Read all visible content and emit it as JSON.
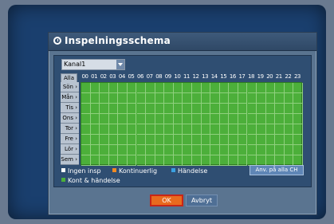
{
  "dialog": {
    "title": "Inspelningsschema",
    "channel_select": "Kanal1",
    "all_label": "Alla",
    "hours": [
      "00",
      "01",
      "02",
      "03",
      "04",
      "05",
      "06",
      "07",
      "08",
      "09",
      "10",
      "11",
      "12",
      "13",
      "14",
      "15",
      "16",
      "17",
      "18",
      "19",
      "20",
      "21",
      "22",
      "23"
    ],
    "days": [
      "Sön",
      "Mån",
      "Tis",
      "Ons",
      "Tor",
      "Fre",
      "Lör",
      "Sem"
    ],
    "legend": [
      {
        "label": "Ingen insp",
        "color": "#ffffff"
      },
      {
        "label": "Kontinuerlig",
        "color": "#f08a24"
      },
      {
        "label": "Händelse",
        "color": "#3aa0e0"
      },
      {
        "label": "Kont & händelse",
        "color": "#4caf3a"
      }
    ],
    "apply_all_label": "Anv. på alla CH",
    "ok_label": "OK",
    "cancel_label": "Avbryt",
    "grid_fill": "Kont & händelse"
  }
}
